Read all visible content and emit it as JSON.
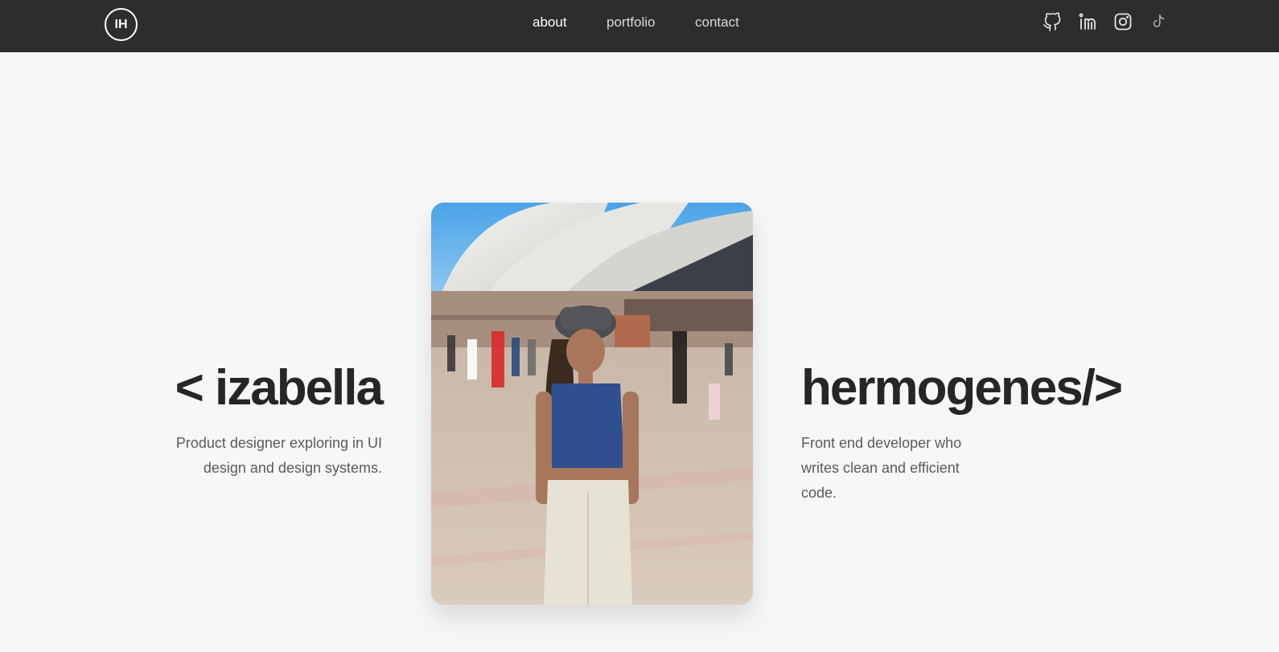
{
  "header": {
    "logo_text": "IH",
    "nav": [
      {
        "label": "about",
        "active": true
      },
      {
        "label": "portfolio",
        "active": false
      },
      {
        "label": "contact",
        "active": false
      }
    ],
    "social_icons": [
      "github-icon",
      "linkedin-icon",
      "instagram-icon",
      "tiktok-icon"
    ]
  },
  "hero": {
    "first_name": "< izabella",
    "last_name": "hermogenes/>",
    "left_description": "Product designer exploring in UI design and design systems.",
    "right_description": "Front end developer who writes clean and efficient code.",
    "photo_icon": "portrait-photo"
  },
  "colors": {
    "header_bg": "#2d2d2d",
    "page_bg": "#f7f7f7",
    "heading_text": "#262626",
    "body_text": "#5a5a5a"
  }
}
